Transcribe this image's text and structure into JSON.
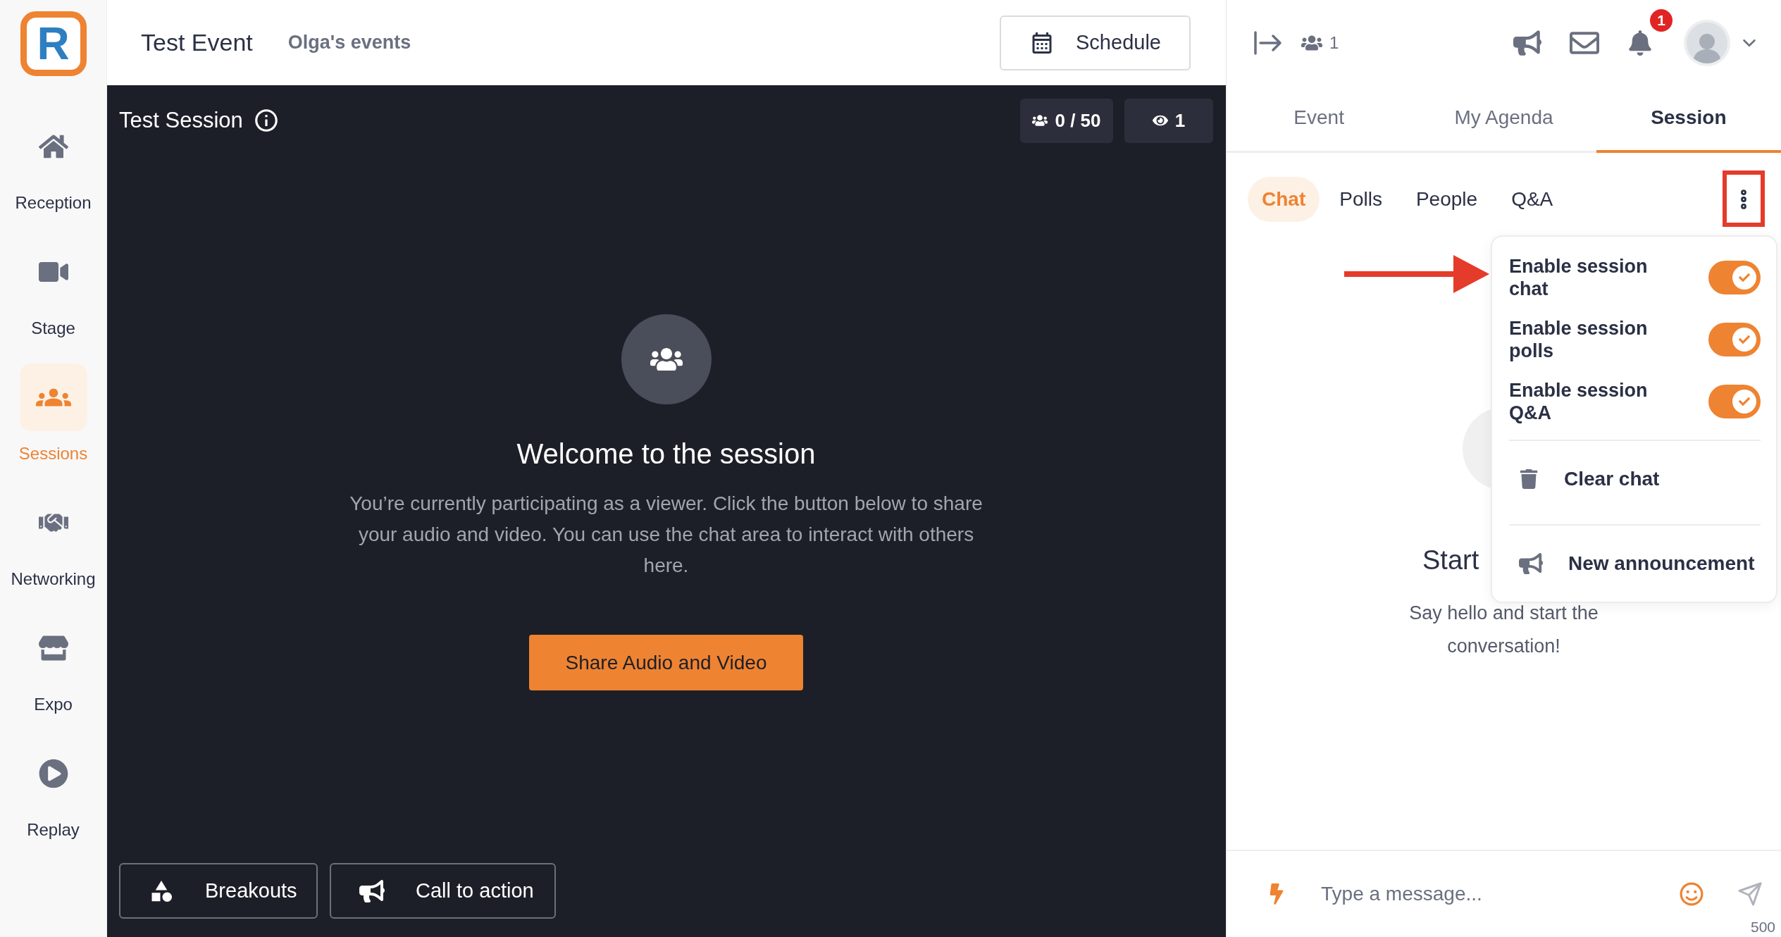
{
  "logo_text": "R",
  "sidebar": {
    "items": [
      {
        "label": "Reception",
        "selected": false
      },
      {
        "label": "Stage",
        "selected": false
      },
      {
        "label": "Sessions",
        "selected": true
      },
      {
        "label": "Networking",
        "selected": false
      },
      {
        "label": "Expo",
        "selected": false
      },
      {
        "label": "Replay",
        "selected": false
      }
    ]
  },
  "header": {
    "event_title": "Test Event",
    "organizer": "Olga's events",
    "schedule_button": "Schedule"
  },
  "stage": {
    "title": "Test Session",
    "participants": "0 / 50",
    "viewers": "1",
    "welcome_title": "Welcome to the session",
    "welcome_text": "You’re currently participating as a viewer. Click the button below to share your audio and video. You can use the chat area to interact with others here.",
    "share_button": "Share Audio and Video",
    "actions": [
      "Breakouts",
      "Call to action"
    ]
  },
  "panel": {
    "attendee_count": "1",
    "notification_count": "1",
    "tabs": [
      {
        "label": "Event",
        "selected": false
      },
      {
        "label": "My Agenda",
        "selected": false
      },
      {
        "label": "Session",
        "selected": true
      }
    ],
    "subtabs": [
      {
        "label": "Chat",
        "selected": true
      },
      {
        "label": "Polls",
        "selected": false
      },
      {
        "label": "People",
        "selected": false
      },
      {
        "label": "Q&A",
        "selected": false
      }
    ],
    "menu": {
      "toggles": [
        {
          "label": "Enable session chat",
          "on": true
        },
        {
          "label": "Enable session polls",
          "on": true
        },
        {
          "label": "Enable session Q&A",
          "on": true
        }
      ],
      "actions": [
        "Clear chat",
        "New announcement"
      ]
    },
    "empty_title": "Start",
    "empty_text": "Say hello and start the conversation!",
    "composer": {
      "placeholder": "Type a message...",
      "char_limit": "500"
    }
  }
}
